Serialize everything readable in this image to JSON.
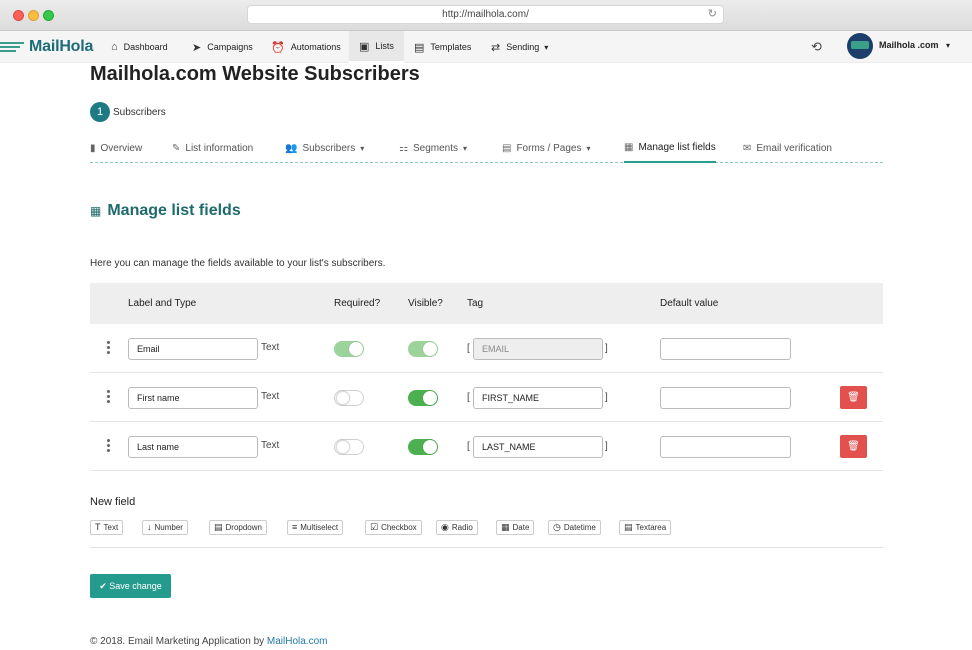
{
  "browser": {
    "url": "http://mailhola.com/"
  },
  "nav": {
    "logo": "MailHola",
    "items": [
      {
        "label": "Dashboard",
        "icon": "home-icon"
      },
      {
        "label": "Campaigns",
        "icon": "paper-plane-icon"
      },
      {
        "label": "Automations",
        "icon": "alarm-clock-icon"
      },
      {
        "label": "Lists",
        "icon": "address-book-icon",
        "active": true
      },
      {
        "label": "Templates",
        "icon": "template-icon"
      },
      {
        "label": "Sending",
        "icon": "exchange-icon"
      }
    ],
    "user": "Mailhola .com"
  },
  "page": {
    "title": "Mailhola.com Website Subscribers",
    "subscriber_count": "1",
    "subscriber_label": "Subscribers",
    "tabs": [
      {
        "label": "Overview"
      },
      {
        "label": "List information"
      },
      {
        "label": "Subscribers"
      },
      {
        "label": "Segments"
      },
      {
        "label": "Forms / Pages"
      },
      {
        "label": "Manage list fields",
        "active": true
      },
      {
        "label": "Email verification"
      }
    ],
    "section_title": "Manage list fields",
    "description": "Here you can manage the fields available to your list's subscribers."
  },
  "table": {
    "headers": {
      "label_type": "Label and Type",
      "required": "Required?",
      "visible": "Visible?",
      "tag": "Tag",
      "default": "Default value"
    },
    "rows": [
      {
        "label": "Email",
        "type": "Text",
        "required": true,
        "visible": true,
        "tag": "EMAIL",
        "default": "",
        "locked": true
      },
      {
        "label": "First name",
        "type": "Text",
        "required": false,
        "visible": true,
        "tag": "FIRST_NAME",
        "default": ""
      },
      {
        "label": "Last name",
        "type": "Text",
        "required": false,
        "visible": true,
        "tag": "LAST_NAME",
        "default": ""
      }
    ]
  },
  "new_field": {
    "title": "New field",
    "types": [
      "Text",
      "Number",
      "Dropdown",
      "Multiselect",
      "Checkbox",
      "Radio",
      "Date",
      "Datetime",
      "Textarea"
    ]
  },
  "save_label": "Save change",
  "footer": {
    "text": "© 2018. Email Marketing Application by ",
    "link": "MailHola.com"
  },
  "colors": {
    "accent": "#249b8c",
    "danger": "#e3514f",
    "toggle_on": "#4caf50"
  }
}
